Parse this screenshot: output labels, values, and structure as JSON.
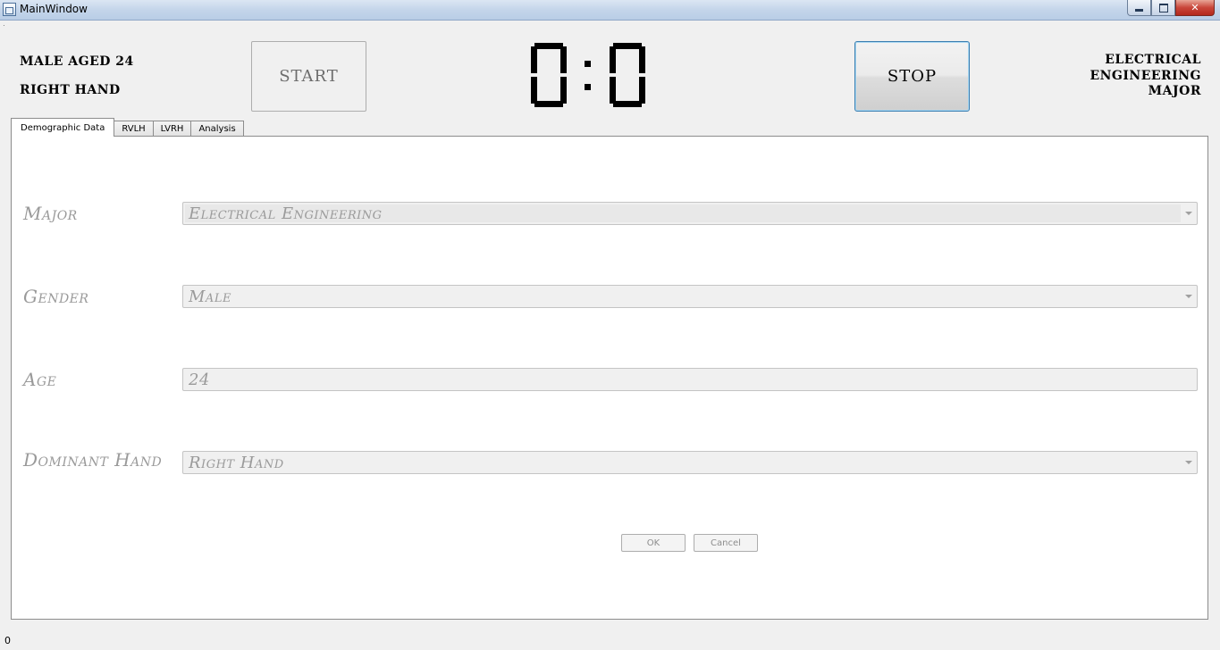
{
  "window": {
    "title": "MainWindow"
  },
  "header": {
    "subject_line1": "MALE AGED 24",
    "subject_line2": "RIGHT HAND",
    "start_label": "START",
    "stop_label": "STOP",
    "timer": {
      "left": "0",
      "separator": ":",
      "right": "0"
    },
    "major_lines": [
      "ELECTRICAL",
      "ENGINEERING",
      "MAJOR"
    ]
  },
  "tabs": [
    {
      "label": "Demographic Data",
      "active": true
    },
    {
      "label": "RVLH",
      "active": false
    },
    {
      "label": "LVRH",
      "active": false
    },
    {
      "label": "Analysis",
      "active": false
    }
  ],
  "form": {
    "major": {
      "label": "Major",
      "value": "Electrical Engineering",
      "type": "select"
    },
    "gender": {
      "label": "Gender",
      "value": "Male",
      "type": "select"
    },
    "age": {
      "label": "Age",
      "value": "24",
      "type": "text"
    },
    "hand": {
      "label": "Dominant Hand",
      "value": "Right Hand",
      "type": "select"
    },
    "ok_label": "OK",
    "cancel_label": "Cancel"
  },
  "status_bar": {
    "text": "0"
  },
  "icons": {
    "app": "window-icon",
    "minimize": "minimize-icon",
    "maximize": "restore-icon",
    "close": "close-icon",
    "dropdown": "chevron-down-icon"
  }
}
